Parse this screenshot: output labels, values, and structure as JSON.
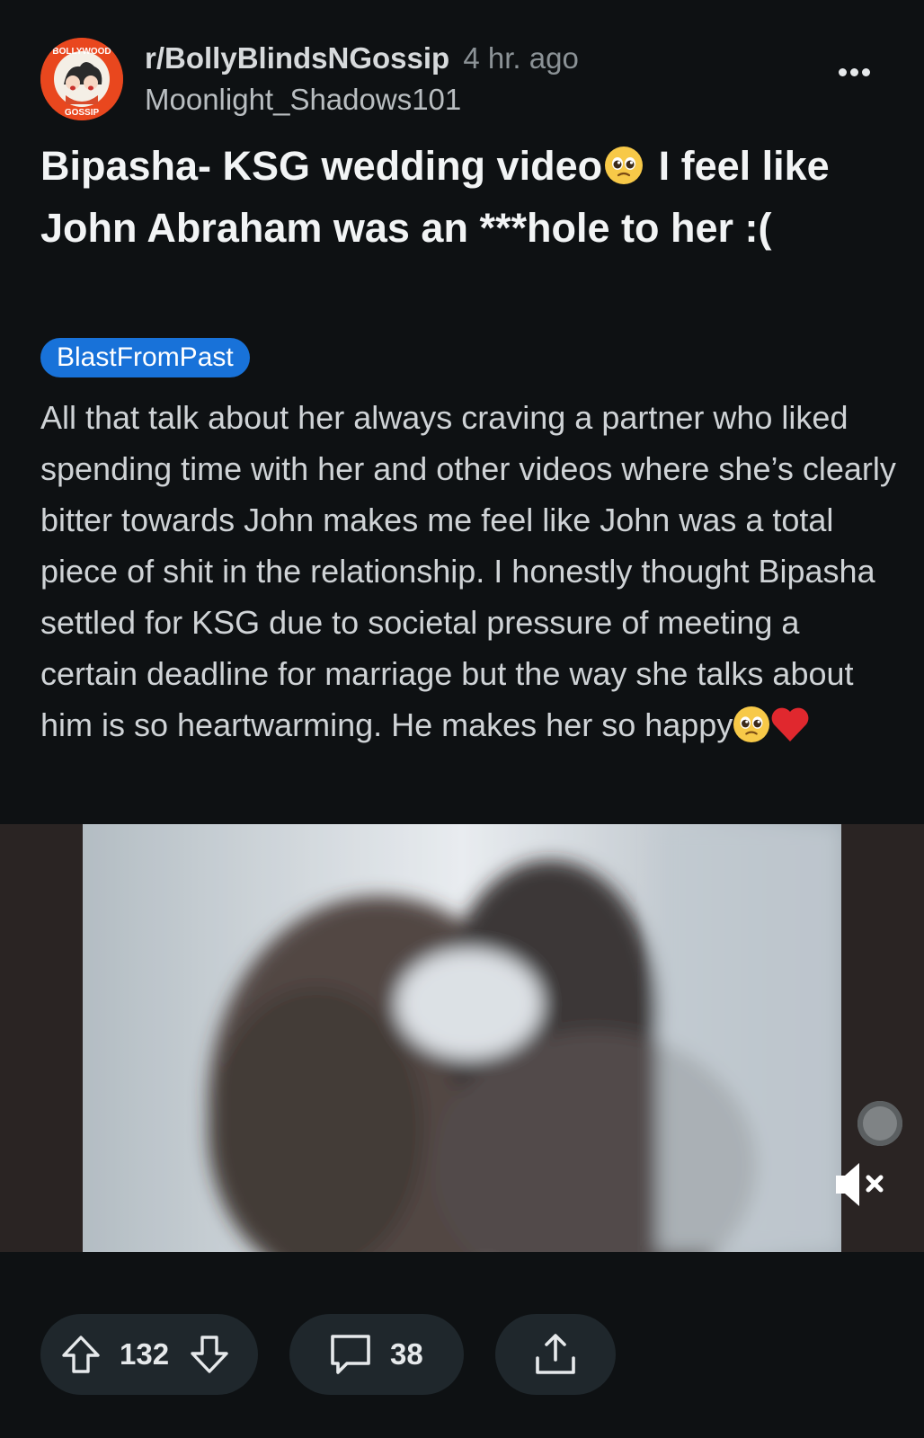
{
  "post": {
    "subreddit": "r/BollyBlindsNGossip",
    "time_ago": "4 hr. ago",
    "author": "Moonlight_Shadows101",
    "avatar_text": [
      "BOLLYWOOD",
      "GOSSIP"
    ],
    "title_part1": "Bipasha- KSG wedding video",
    "title_part2": " I feel like John Abraham was an ***hole to her :(",
    "flair": "BlastFromPast",
    "body": "All that talk about her always craving a partner who liked spending time with her and other videos where she’s clearly bitter towards John makes me feel like John was a total piece of shit in the relationship. I honestly thought Bipasha settled for KSG due to societal pressure of meeting a certain deadline for marriage but the way she talks about him is so heartwarming. He makes her so happy",
    "emojis": [
      "pleading-face-emoji",
      "red-heart-emoji"
    ]
  },
  "media": {
    "type": "video",
    "muted": true,
    "icons": [
      "scrub-handle",
      "mute-icon"
    ]
  },
  "actions": {
    "upvotes": "132",
    "comments": "38",
    "icons": [
      "upvote-icon",
      "downvote-icon",
      "comment-icon",
      "share-icon",
      "more-icon"
    ]
  },
  "colors": {
    "background": "#0e1113",
    "flair_bg": "#1872d9",
    "pill_bg": "#1f272c",
    "avatar_bg": "#e9471e",
    "heart": "#e0282e"
  }
}
